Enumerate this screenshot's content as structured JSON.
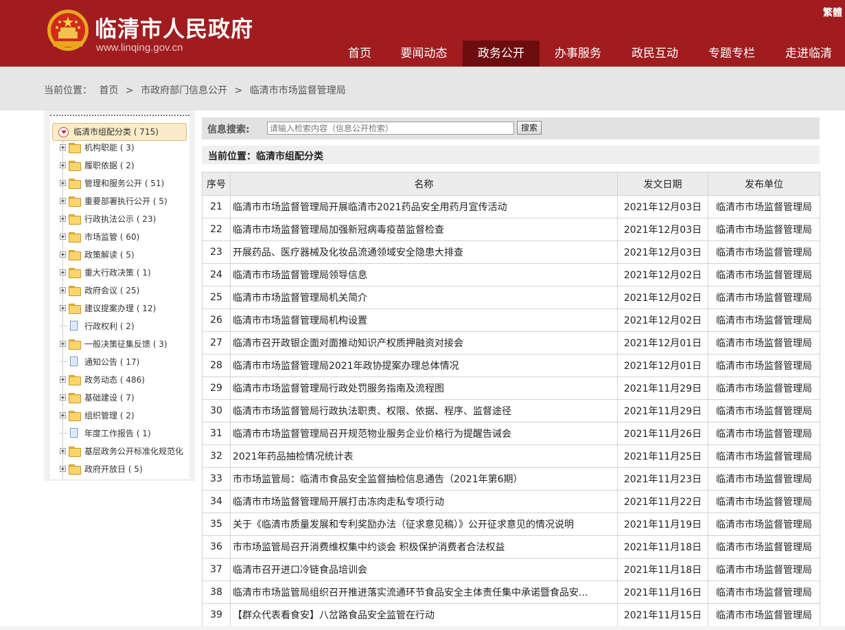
{
  "header": {
    "site_title": "临清市人民政府",
    "site_url": "www.linqing.gov.cn",
    "traditional_toggle": "繁體",
    "brand_color": "#a01c1f",
    "nav": [
      {
        "label": "首页",
        "active": false
      },
      {
        "label": "要闻动态",
        "active": false
      },
      {
        "label": "政务公开",
        "active": true
      },
      {
        "label": "办事服务",
        "active": false
      },
      {
        "label": "政民互动",
        "active": false
      },
      {
        "label": "专题专栏",
        "active": false
      },
      {
        "label": "走进临清",
        "active": false
      }
    ]
  },
  "breadcrumb": {
    "prefix": "当前位置：",
    "items": [
      "首页",
      "市政府部门信息公开",
      "临清市市场监督管理局"
    ],
    "separator": ">"
  },
  "sidebar": {
    "root": {
      "label": "临清市组配分类 ( 715)",
      "icon": "collapse-circle-icon"
    },
    "items": [
      {
        "label": "机构职能 ( 3)",
        "type": "folder"
      },
      {
        "label": "履职依据 ( 2)",
        "type": "folder"
      },
      {
        "label": "管理和服务公开 ( 51)",
        "type": "folder"
      },
      {
        "label": "重要部署执行公开 ( 5)",
        "type": "folder"
      },
      {
        "label": "行政执法公示 ( 23)",
        "type": "folder"
      },
      {
        "label": "市场监管 ( 60)",
        "type": "folder"
      },
      {
        "label": "政策解读 ( 5)",
        "type": "folder"
      },
      {
        "label": "重大行政决策 ( 1)",
        "type": "folder"
      },
      {
        "label": "政府会议 ( 25)",
        "type": "folder"
      },
      {
        "label": "建议提案办理 ( 12)",
        "type": "folder"
      },
      {
        "label": "行政权利 ( 2)",
        "type": "doc"
      },
      {
        "label": "一般决策征集反馈 ( 3)",
        "type": "folder"
      },
      {
        "label": "通知公告 ( 17)",
        "type": "doc"
      },
      {
        "label": "政务动态 ( 486)",
        "type": "folder"
      },
      {
        "label": "基础建设 ( 7)",
        "type": "folder"
      },
      {
        "label": "组织管理 ( 2)",
        "type": "folder"
      },
      {
        "label": "年度工作报告 ( 1)",
        "type": "doc"
      },
      {
        "label": "基层政务公开标准化规范化",
        "type": "folder"
      },
      {
        "label": "政府开放日 ( 5)",
        "type": "folder"
      }
    ]
  },
  "search": {
    "label": "信息搜索:",
    "placeholder": "请输入检索内容（信息公开检索）",
    "button": "搜索"
  },
  "location": {
    "text": "当前位置：临清市组配分类"
  },
  "table": {
    "headers": [
      "序号",
      "名称",
      "发文日期",
      "发布单位"
    ],
    "rows": [
      {
        "num": "21",
        "title": "临清市市场监督管理局开展临清市2021药品安全用药月宣传活动",
        "date": "2021年12月03日",
        "org": "临清市市场监督管理局"
      },
      {
        "num": "22",
        "title": "临清市市场监督管理局加强新冠病毒疫苗监督检查",
        "date": "2021年12月03日",
        "org": "临清市市场监督管理局"
      },
      {
        "num": "23",
        "title": "开展药品、医疗器械及化妆品流通领域安全隐患大排查",
        "date": "2021年12月03日",
        "org": "临清市市场监督管理局"
      },
      {
        "num": "24",
        "title": "临清市市场监督管理局领导信息",
        "date": "2021年12月02日",
        "org": "临清市市场监督管理局"
      },
      {
        "num": "25",
        "title": "临清市市场监督管理局机关简介",
        "date": "2021年12月02日",
        "org": "临清市市场监督管理局"
      },
      {
        "num": "26",
        "title": "临清市市场监督管理局机构设置",
        "date": "2021年12月02日",
        "org": "临清市市场监督管理局"
      },
      {
        "num": "27",
        "title": "临清市召开政银企面对面推动知识产权质押融资对接会",
        "date": "2021年12月01日",
        "org": "临清市市场监督管理局"
      },
      {
        "num": "28",
        "title": "临清市市场监督管理局2021年政协提案办理总体情况",
        "date": "2021年12月01日",
        "org": "临清市市场监督管理局"
      },
      {
        "num": "29",
        "title": "临清市市场监督管理局行政处罚服务指南及流程图",
        "date": "2021年11月29日",
        "org": "临清市市场监督管理局"
      },
      {
        "num": "30",
        "title": "临清市市场监督管局行政执法职责、权限、依据、程序、监督途径",
        "date": "2021年11月29日",
        "org": "临清市市场监督管理局"
      },
      {
        "num": "31",
        "title": "临清市市场监督管理局召开规范物业服务企业价格行为提醒告诫会",
        "date": "2021年11月26日",
        "org": "临清市市场监督管理局"
      },
      {
        "num": "32",
        "title": "2021年药品抽检情况统计表",
        "date": "2021年11月25日",
        "org": "临清市市场监督管理局"
      },
      {
        "num": "33",
        "title": "市市场监管局：临清市食品安全监督抽检信息通告（2021年第6期）",
        "date": "2021年11月23日",
        "org": "临清市市场监督管理局"
      },
      {
        "num": "34",
        "title": "临清市市场监督管理局开展打击冻肉走私专项行动",
        "date": "2021年11月22日",
        "org": "临清市市场监督管理局"
      },
      {
        "num": "35",
        "title": "关于《临清市质量发展和专利奖励办法（征求意见稿）》公开征求意见的情况说明",
        "date": "2021年11月19日",
        "org": "临清市市场监督管理局"
      },
      {
        "num": "36",
        "title": "市市场监管局召开消费维权集中约谈会 积极保护消费者合法权益",
        "date": "2021年11月18日",
        "org": "临清市市场监督管理局"
      },
      {
        "num": "37",
        "title": "临清市召开进口冷链食品培训会",
        "date": "2021年11月18日",
        "org": "临清市市场监督管理局"
      },
      {
        "num": "38",
        "title": "临清市市场监管局组织召开推进落实流通环节食品安全主体责任集中承诺暨食品安...",
        "date": "2021年11月16日",
        "org": "临清市市场监督管理局"
      },
      {
        "num": "39",
        "title": "【群众代表看食安】八岔路食品安全监管在行动",
        "date": "2021年11月15日",
        "org": "临清市市场监督管理局"
      }
    ]
  }
}
